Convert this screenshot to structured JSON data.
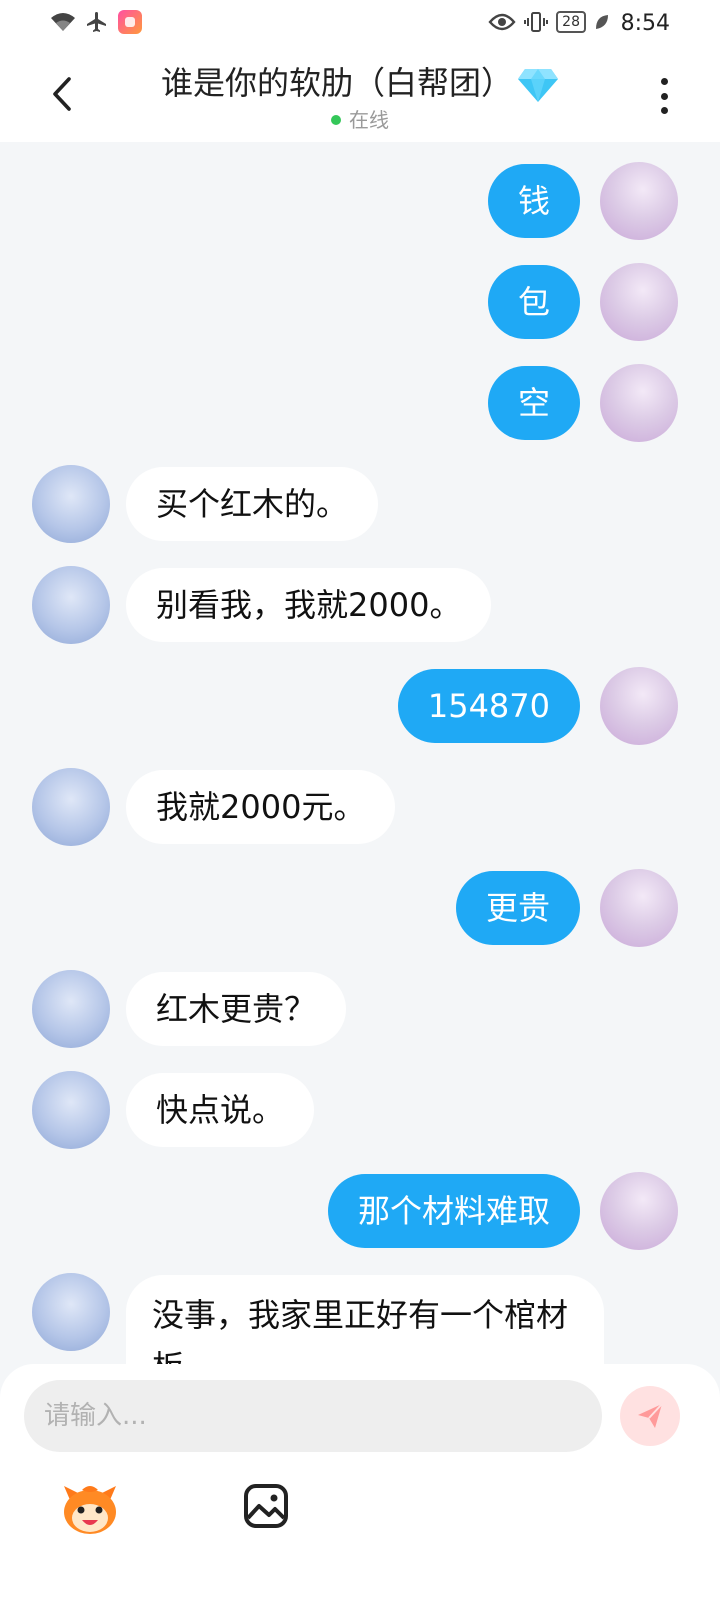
{
  "status_bar": {
    "time": "8:54",
    "battery": "28",
    "icons": [
      "wifi-icon",
      "airplane-icon",
      "app-icon",
      "eye-icon",
      "vibrate-icon",
      "battery-icon",
      "leaf-icon"
    ]
  },
  "header": {
    "title": "谁是你的软肋（白帮团）",
    "title_icon": "diamond-icon",
    "status": "在线",
    "status_color": "#34c759"
  },
  "messages": [
    {
      "side": "user",
      "text": "钱"
    },
    {
      "side": "user",
      "text": "包"
    },
    {
      "side": "user",
      "text": "空"
    },
    {
      "side": "bot",
      "text": "买个红木的。"
    },
    {
      "side": "bot",
      "text": "别看我，我就2000。"
    },
    {
      "side": "user",
      "text": "154870"
    },
    {
      "side": "bot",
      "text": "我就2000元。"
    },
    {
      "side": "user",
      "text": "更贵"
    },
    {
      "side": "bot",
      "text": "红木更贵？"
    },
    {
      "side": "bot",
      "text": "快点说。"
    },
    {
      "side": "user",
      "text": "那个材料难取"
    },
    {
      "side": "bot",
      "text": "没事，我家里正好有一个棺材板。"
    }
  ],
  "input": {
    "placeholder": "请输入...",
    "value": ""
  },
  "toolbar": {
    "emoji_icon": "mascot-emoji-icon",
    "image_icon": "image-icon",
    "send_icon": "send-icon"
  },
  "colors": {
    "accent": "#1fa9f5",
    "background": "#f4f6f8",
    "send_button_bg": "#ffe1e1",
    "send_icon": "#ff9a9a"
  }
}
